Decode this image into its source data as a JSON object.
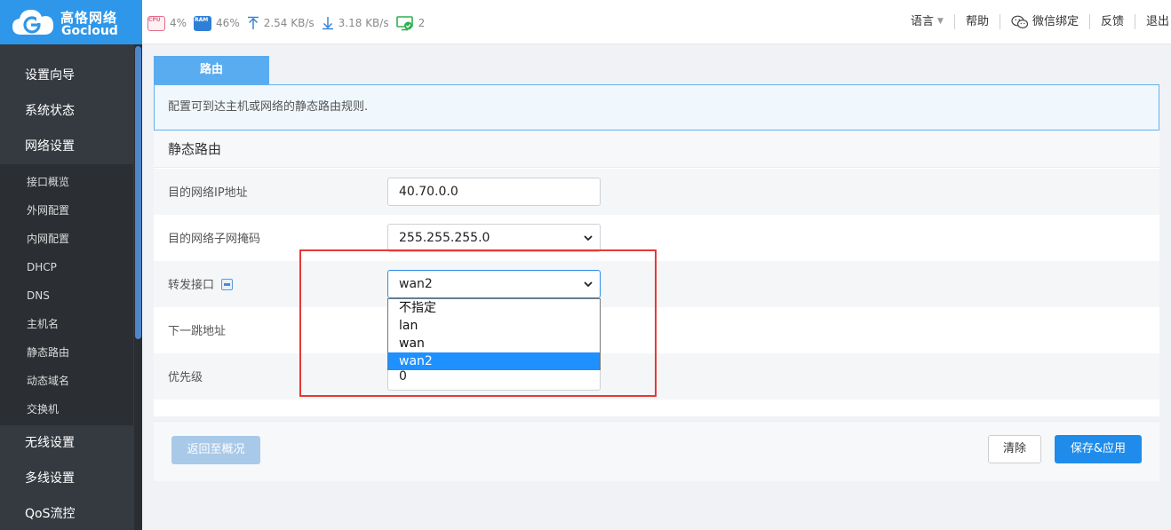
{
  "brand": {
    "name_cn": "高恪网络",
    "name_en": "Gocloud"
  },
  "stats": {
    "cpu_chip": "CPU",
    "cpu": "4%",
    "ram_chip": "RAM",
    "ram": "46%",
    "upload": "2.54 KB/s",
    "download": "3.18 KB/s",
    "devices": "2"
  },
  "topnav": {
    "language": "语言",
    "help": "帮助",
    "wechat": "微信绑定",
    "feedback": "反馈",
    "logout": "退出"
  },
  "sidebar": {
    "items": [
      "设置向导",
      "系统状态",
      "网络设置"
    ],
    "sub_items": [
      "接口概览",
      "外网配置",
      "内网配置",
      "DHCP",
      "DNS",
      "主机名",
      "静态路由",
      "动态域名",
      "交换机"
    ],
    "items_after": [
      "无线设置",
      "多线设置",
      "QoS流控"
    ]
  },
  "tab": {
    "label": "路由"
  },
  "description": "配置可到达主机或网络的静态路由规则.",
  "form": {
    "title": "静态路由",
    "dest_ip_label": "目的网络IP地址",
    "dest_ip_value": "40.70.0.0",
    "netmask_label": "目的网络子网掩码",
    "netmask_value": "255.255.255.0",
    "interface_label": "转发接口",
    "interface_value": "wan2",
    "nexthop_label": "下一跳地址",
    "priority_label": "优先级",
    "priority_value": "0"
  },
  "dropdown": {
    "options": [
      "不指定",
      "lan",
      "wan",
      "wan2"
    ],
    "selected": "wan2"
  },
  "footer": {
    "back_label": "返回至概况",
    "clear_label": "清除",
    "save_label": "保存&应用"
  },
  "colors": {
    "brand": "#2e97ea",
    "sidebar": "#343a40",
    "primary_button": "#1f8ceb",
    "highlight_box": "#e53935"
  }
}
